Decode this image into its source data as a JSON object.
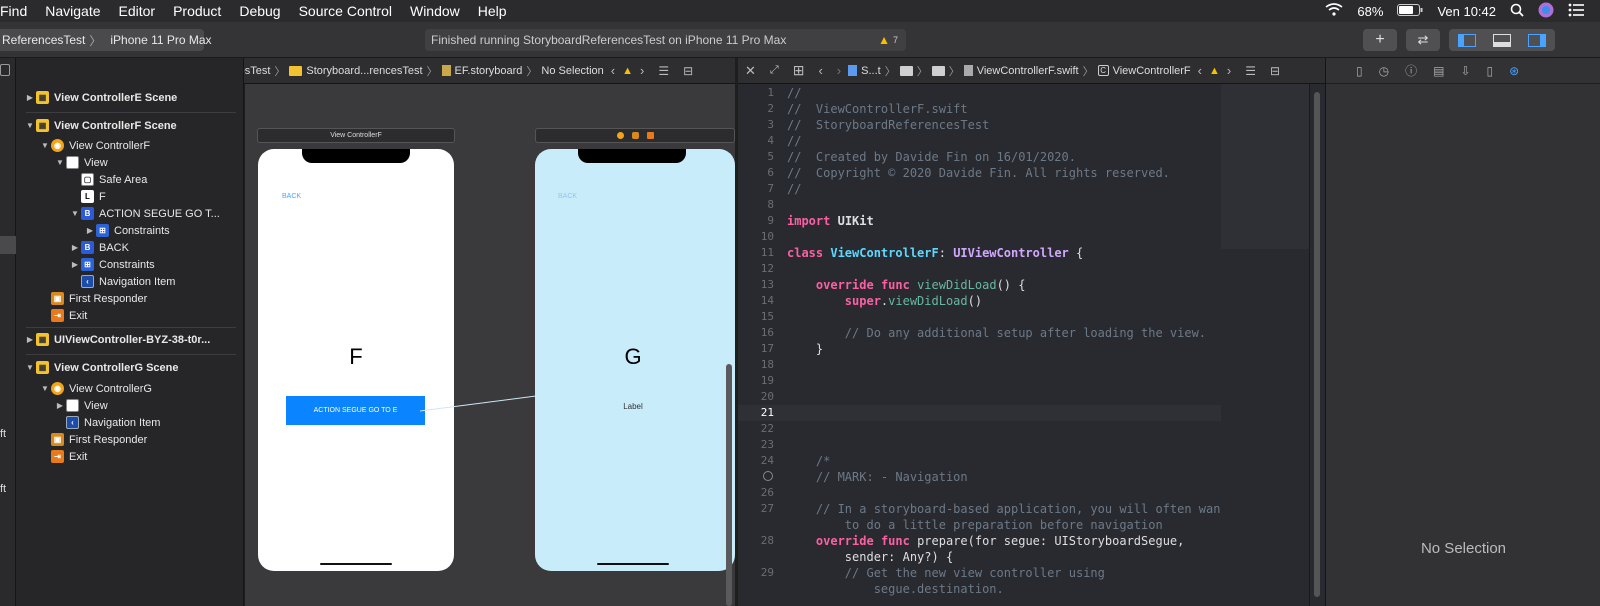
{
  "menubar": {
    "items": [
      "Find",
      "Navigate",
      "Editor",
      "Product",
      "Debug",
      "Source Control",
      "Window",
      "Help"
    ],
    "battery": "68%",
    "clock": "Ven 10:42"
  },
  "toolbar": {
    "scheme": "ReferencesTest",
    "device": "iPhone 11 Pro Max",
    "status": "Finished running StoryboardReferencesTest on iPhone 11 Pro Max",
    "warning_count": "7"
  },
  "left_jumpbar": {
    "crumbs": [
      "StoryboardReferencesTest",
      "Storyboard...rencesTest",
      "EF.storyboard",
      "No Selection"
    ]
  },
  "right_jumpbar": {
    "crumbs": [
      "S...t",
      "ViewControllerF.swift",
      "ViewControllerF"
    ]
  },
  "outline": {
    "items": [
      {
        "label": "View ControllerE Scene"
      },
      {
        "label": "View ControllerF Scene"
      },
      {
        "label": "View ControllerF"
      },
      {
        "label": "View"
      },
      {
        "label": "Safe Area"
      },
      {
        "label": "F"
      },
      {
        "label": "ACTION SEGUE GO T..."
      },
      {
        "label": "Constraints"
      },
      {
        "label": "BACK"
      },
      {
        "label": "Constraints"
      },
      {
        "label": "Navigation Item"
      },
      {
        "label": "First Responder"
      },
      {
        "label": "Exit"
      },
      {
        "label": "UIViewController-BYZ-38-t0r..."
      },
      {
        "label": "View ControllerG Scene"
      },
      {
        "label": "View ControllerG"
      },
      {
        "label": "View"
      },
      {
        "label": "Navigation Item"
      },
      {
        "label": "First Responder"
      },
      {
        "label": "Exit"
      }
    ]
  },
  "left_strip": {
    "frag1": "ft",
    "frag2": "ft"
  },
  "canvas": {
    "scene_f_title": "View ControllerF",
    "back_label_f": "BACK",
    "big_label_f": "F",
    "action_button": "ACTION SEGUE GO TO E",
    "back_label_g": "BACK",
    "big_label_g": "G",
    "small_label_g": "Label"
  },
  "editor": {
    "lines": [
      {
        "n": "1",
        "t": "//"
      },
      {
        "n": "2",
        "t": "//  ViewControllerF.swift"
      },
      {
        "n": "3",
        "t": "//  StoryboardReferencesTest"
      },
      {
        "n": "4",
        "t": "//"
      },
      {
        "n": "5",
        "t": "//  Created by Davide Fin on 16/01/2020."
      },
      {
        "n": "6",
        "t": "//  Copyright © 2020 Davide Fin. All rights reserved."
      },
      {
        "n": "7",
        "t": "//"
      },
      {
        "n": "8",
        "t": ""
      },
      {
        "n": "9",
        "t": "import UIKit"
      },
      {
        "n": "10",
        "t": ""
      },
      {
        "n": "11",
        "t": "class ViewControllerF: UIViewController {"
      },
      {
        "n": "12",
        "t": ""
      },
      {
        "n": "13",
        "t": "    override func viewDidLoad() {"
      },
      {
        "n": "14",
        "t": "        super.viewDidLoad()"
      },
      {
        "n": "15",
        "t": ""
      },
      {
        "n": "16",
        "t": "        // Do any additional setup after loading the view."
      },
      {
        "n": "17",
        "t": "    }"
      },
      {
        "n": "18",
        "t": ""
      },
      {
        "n": "19",
        "t": ""
      },
      {
        "n": "20",
        "t": ""
      },
      {
        "n": "21",
        "t": ""
      },
      {
        "n": "22",
        "t": ""
      },
      {
        "n": "23",
        "t": ""
      },
      {
        "n": "24",
        "t": "    /*"
      },
      {
        "n": "",
        "t": "    // MARK: - Navigation"
      },
      {
        "n": "26",
        "t": ""
      },
      {
        "n": "27",
        "t": "    // In a storyboard-based application, you will often want"
      },
      {
        "n": "",
        "t": "        to do a little preparation before navigation"
      },
      {
        "n": "28",
        "t": "    override func prepare(for segue: UIStoryboardSegue,"
      },
      {
        "n": "",
        "t": "        sender: Any?) {"
      },
      {
        "n": "29",
        "t": "        // Get the new view controller using"
      },
      {
        "n": "",
        "t": "            segue.destination."
      }
    ]
  },
  "inspector": {
    "empty_text": "No Selection"
  },
  "colors": {
    "accent": "#0a84ff",
    "phone_g_bg": "#c8ecfa",
    "action_button_bg": "#0a84ff"
  }
}
